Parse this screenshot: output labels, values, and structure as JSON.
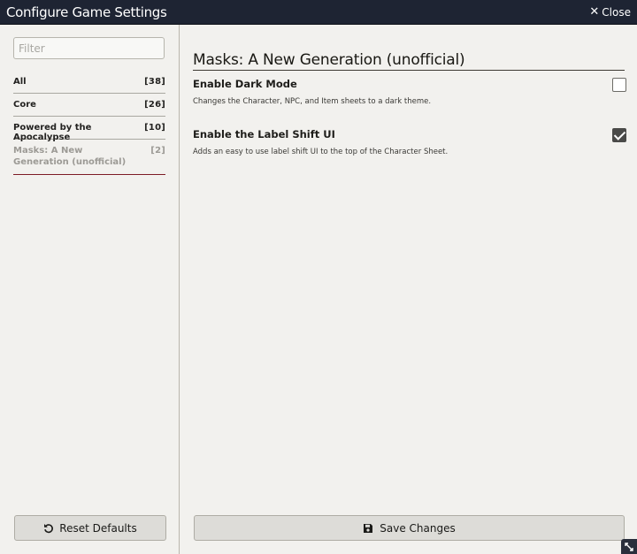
{
  "window": {
    "title": "Configure Game Settings",
    "close_label": "Close"
  },
  "sidebar": {
    "filter_placeholder": "Filter",
    "categories": [
      {
        "name": "All",
        "count": "[38]"
      },
      {
        "name": "Core",
        "count": "[26]"
      },
      {
        "name": "Powered by the Apocalypse",
        "count": "[10]"
      },
      {
        "name": "Masks: A New Generation (unofficial)",
        "count": "[2]",
        "active": true
      }
    ],
    "reset_label": "Reset Defaults"
  },
  "main": {
    "section_title": "Masks: A New Generation (unofficial)",
    "settings": [
      {
        "label": "Enable Dark Mode",
        "hint": "Changes the Character, NPC, and Item sheets to a dark theme.",
        "checked": false
      },
      {
        "label": "Enable the Label Shift UI",
        "hint": "Adds an easy to use label shift UI to the top of the Character Sheet.",
        "checked": true
      }
    ],
    "save_label": "Save Changes"
  },
  "icons": {
    "close": "close-icon",
    "reset": "undo-icon",
    "save": "floppy-disk-icon",
    "resize": "resize-icon"
  },
  "colors": {
    "titlebar": "#1e2433",
    "background": "#f2f1ee",
    "active_category_underline": "#7d1b26"
  }
}
